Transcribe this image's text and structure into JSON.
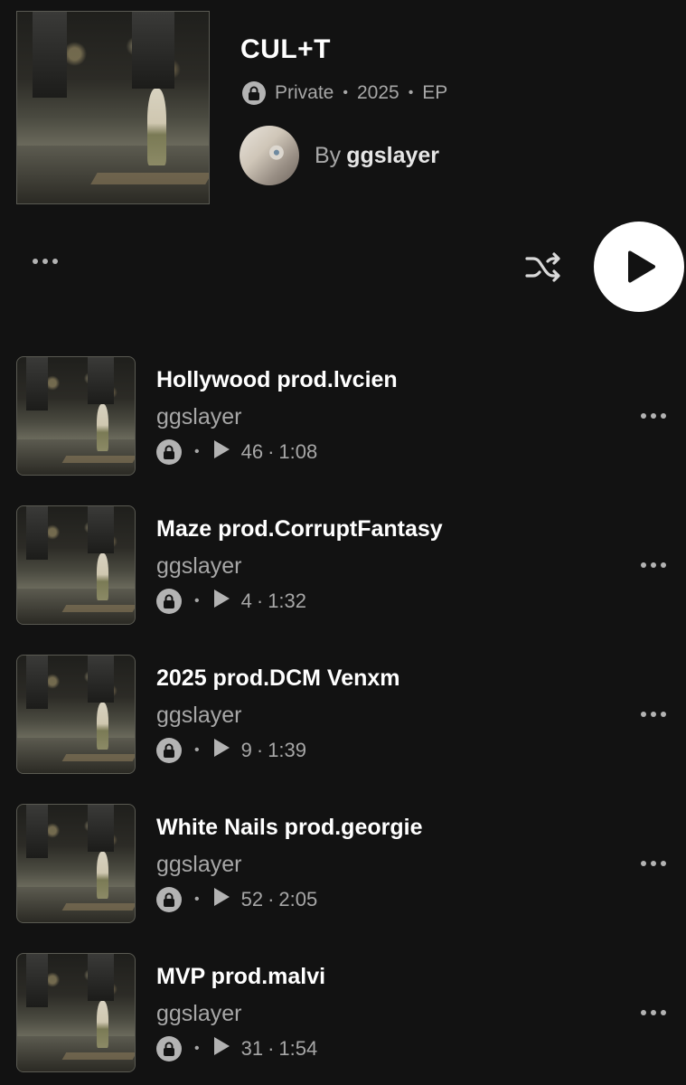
{
  "album": {
    "title": "CUL+T",
    "visibility": "Private",
    "year": "2025",
    "type": "EP",
    "by_label": "By",
    "artist": "ggslayer"
  },
  "icons": {
    "lock": "lock-icon",
    "more": "more-horizontal-icon",
    "shuffle": "shuffle-icon",
    "play": "play-icon",
    "plays": "play-count-icon"
  },
  "colors": {
    "background": "#121212",
    "text_secondary": "#a7a7a7",
    "play_button": "#ffffff"
  },
  "tracks": [
    {
      "title": "Hollywood prod.lvcien",
      "artist": "ggslayer",
      "plays": "46",
      "duration": "1:08"
    },
    {
      "title": "Maze prod.CorruptFantasy",
      "artist": "ggslayer",
      "plays": "4",
      "duration": "1:32"
    },
    {
      "title": "2025 prod.DCM Venxm",
      "artist": "ggslayer",
      "plays": "9",
      "duration": "1:39"
    },
    {
      "title": "White Nails prod.georgie",
      "artist": "ggslayer",
      "plays": "52",
      "duration": "2:05"
    },
    {
      "title": "MVP prod.malvi",
      "artist": "ggslayer",
      "plays": "31",
      "duration": "1:54"
    }
  ]
}
